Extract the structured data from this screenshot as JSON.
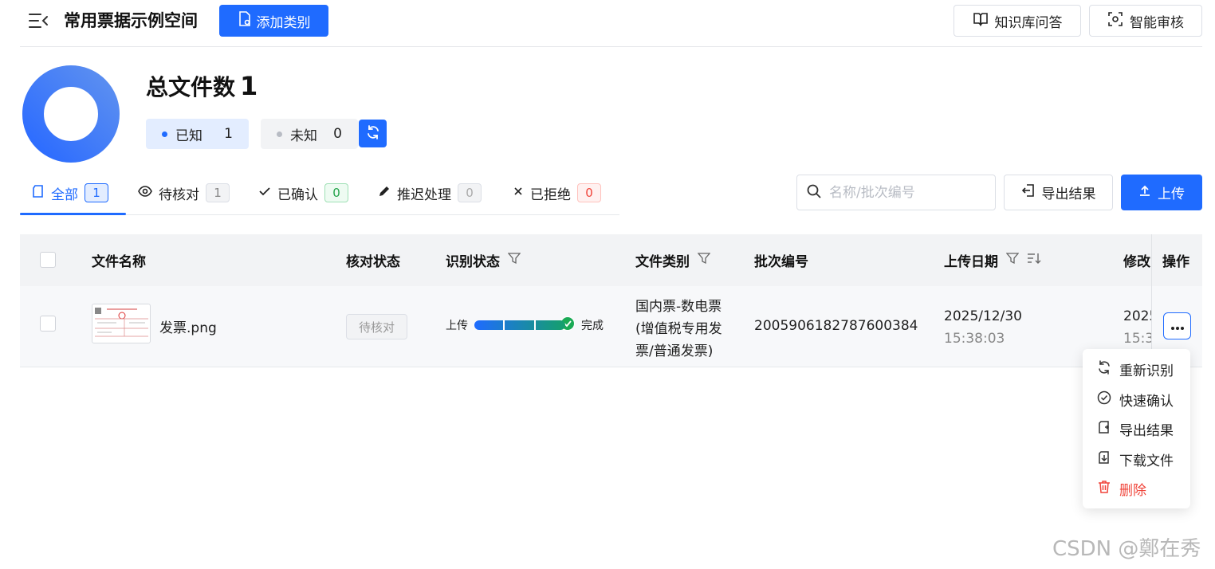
{
  "header": {
    "title": "常用票据示例空间",
    "add_category_label": "添加类别",
    "kb_qa_label": "知识库问答",
    "smart_review_label": "智能审核"
  },
  "summary": {
    "total_label": "总文件数",
    "total_value": "1",
    "known_label": "已知",
    "known_count": "1",
    "unknown_label": "未知",
    "unknown_count": "0",
    "known_fraction": 1.0
  },
  "tabs": [
    {
      "icon": "file-icon",
      "label": "全部",
      "count": "1",
      "active": true
    },
    {
      "icon": "eye-icon",
      "label": "待核对",
      "count": "1",
      "active": false
    },
    {
      "icon": "check-icon",
      "label": "已确认",
      "count": "0",
      "active": false
    },
    {
      "icon": "pen-icon",
      "label": "推迟处理",
      "count": "0",
      "active": false
    },
    {
      "icon": "close-icon",
      "label": "已拒绝",
      "count": "0",
      "active": false
    }
  ],
  "toolbar": {
    "search_placeholder": "名称/批次编号",
    "export_label": "导出结果",
    "upload_label": "上传"
  },
  "table": {
    "columns": {
      "file_name": "文件名称",
      "verify_status": "核对状态",
      "recognition_status": "识别状态",
      "file_category": "文件类别",
      "batch_no": "批次编号",
      "upload_date": "上传日期",
      "modified": "修改",
      "actions": "操作"
    },
    "rows": [
      {
        "file_name": "发票.png",
        "verify_status": "待核对",
        "recognition_start": "上传",
        "recognition_end": "完成",
        "recognition_progress": 1.0,
        "category_line1": "国内票-数电票",
        "category_line2": "(增值税专用发",
        "category_line3": "票/普通发票)",
        "batch_no": "2005906182787600384",
        "upload_date": "2025/12/30",
        "upload_time": "15:38:03",
        "modified_date": "2025",
        "modified_time": "15:3"
      }
    ]
  },
  "row_menu": {
    "items": [
      {
        "icon": "refresh-icon",
        "label": "重新识别"
      },
      {
        "icon": "check-circle-icon",
        "label": "快速确认"
      },
      {
        "icon": "export-icon",
        "label": "导出结果"
      },
      {
        "icon": "download-icon",
        "label": "下载文件"
      },
      {
        "icon": "trash-icon",
        "label": "删除",
        "danger": true
      }
    ]
  },
  "watermark": "CSDN @鄭在秀",
  "colors": {
    "primary": "#1f6bff",
    "success": "#22a34a",
    "danger": "#f0443a"
  }
}
